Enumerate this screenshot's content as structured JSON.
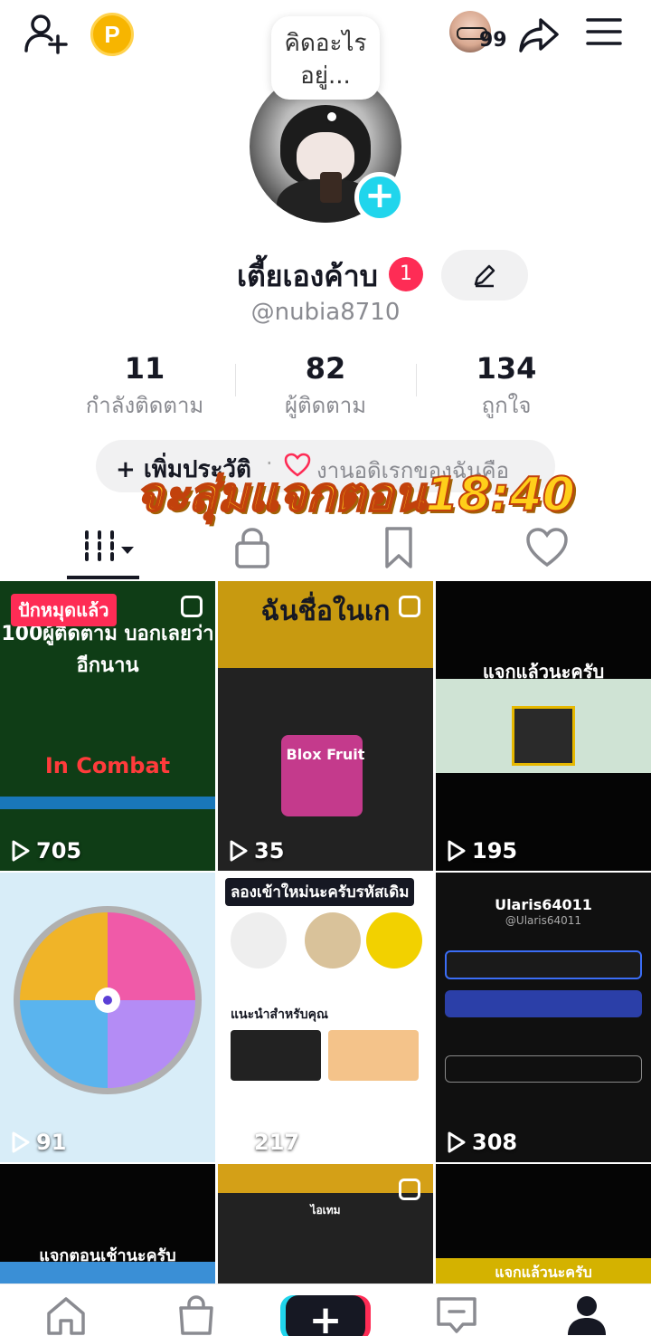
{
  "header": {
    "coin_label": "P",
    "story_count": "99",
    "thought_bubble": [
      "คิดอะไร",
      "อยู่..."
    ]
  },
  "profile": {
    "name": "เตี้ยเองค้าบ",
    "notification_count": "1",
    "handle": "@nubia8710",
    "add_button": "+"
  },
  "stats": [
    {
      "value": "11",
      "label": "กำลังติดตาม"
    },
    {
      "value": "82",
      "label": "ผู้ติดตาม"
    },
    {
      "value": "134",
      "label": "ถูกใจ"
    }
  ],
  "bio": {
    "add_bio": "+ เพิ่มประวัติ",
    "separator": "·",
    "favorites": "งานอดิเรกของฉันคือ"
  },
  "overlay_caption": "จะสุ่มแจกตอน18:40",
  "videos": [
    {
      "views": "705",
      "pinned": "ปักหมุดแล้ว",
      "caption": "100ผู้ติดตาม บอกเลยว่าอีกนาน",
      "sub": "In Combat",
      "bg": "#0f3d16"
    },
    {
      "views": "35",
      "caption": "ฉันชื่อในเก",
      "sub": "Blox Fruit",
      "bg": "#b8860b"
    },
    {
      "views": "195",
      "caption": "แจกแล้วนะครับ",
      "bg": "#050505"
    },
    {
      "views": "91",
      "caption": "",
      "bg": "#d8edf8"
    },
    {
      "views": "217",
      "caption": "ลองเข้าใหม่นะครับรหัสเดิม",
      "sub": "แนะนำสำหรับคุณ",
      "bg": "#ffffff"
    },
    {
      "views": "308",
      "caption": "Ularis64011",
      "sub": "@Ularis64011",
      "bg": "#101010"
    },
    {
      "views": "",
      "caption": "แจกตอนเช้านะครับ",
      "bg": "#050505"
    },
    {
      "views": "",
      "caption": "ไอเทม",
      "bg": "#d4a017"
    },
    {
      "views": "",
      "caption": "แจกแล้วนะครับ",
      "bg": "#050505"
    }
  ]
}
